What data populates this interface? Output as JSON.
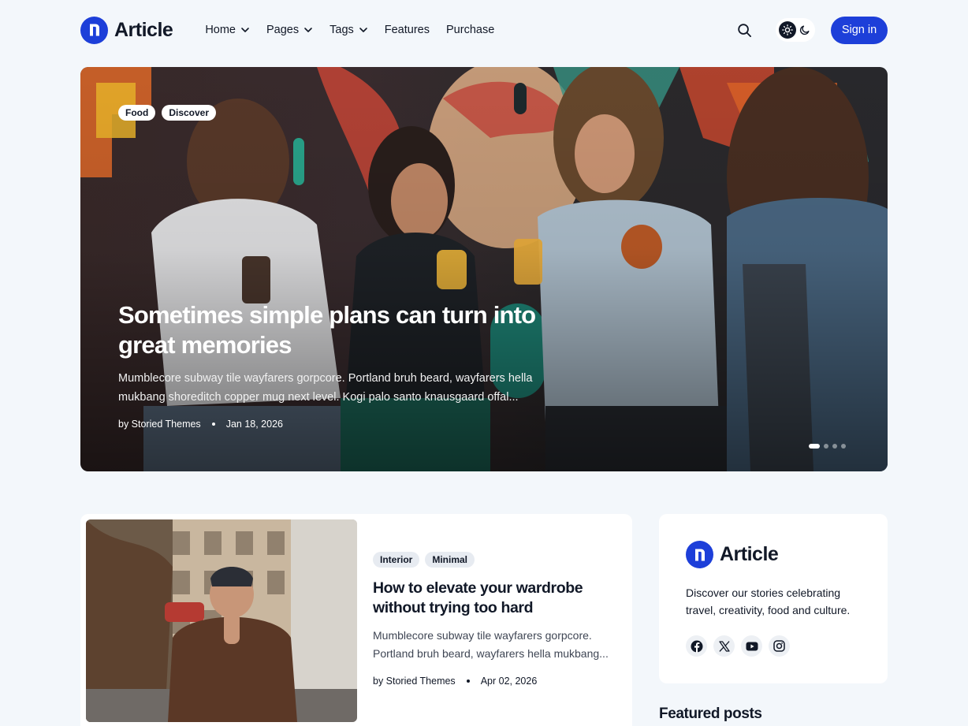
{
  "brand": {
    "name": "Article",
    "color": "#1d3fd9"
  },
  "nav": {
    "items": [
      {
        "label": "Home",
        "has_dropdown": true
      },
      {
        "label": "Pages",
        "has_dropdown": true
      },
      {
        "label": "Tags",
        "has_dropdown": true
      },
      {
        "label": "Features",
        "has_dropdown": false
      },
      {
        "label": "Purchase",
        "has_dropdown": false
      }
    ],
    "search_icon": "search-icon",
    "theme_toggle": {
      "icons": [
        "sun-icon",
        "moon-icon"
      ],
      "active": "light"
    },
    "signin_label": "Sign in"
  },
  "hero": {
    "tags": [
      "Food",
      "Discover"
    ],
    "title": "Sometimes simple plans can turn into great memories",
    "excerpt": "Mumblecore subway tile wayfarers gorpcore. Portland bruh beard, wayfarers hella mukbang shoreditch copper mug next level. Kogi palo santo knausgaard offal...",
    "author": "by Storied Themes",
    "date": "Jan 18, 2026",
    "slides_total": 4,
    "active_slide": 1
  },
  "post": {
    "tags": [
      "Interior",
      "Minimal"
    ],
    "title": "How to elevate your wardrobe without trying too hard",
    "excerpt": "Mumblecore subway tile wayfarers gorpcore. Portland bruh beard, wayfarers hella mukbang...",
    "author": "by Storied Themes",
    "date": "Apr 02, 2026"
  },
  "sidebar": {
    "brand_name": "Article",
    "description": "Discover our stories celebrating travel, creativity, food and culture.",
    "social_icons": [
      "facebook-icon",
      "x-icon",
      "youtube-icon",
      "instagram-icon"
    ],
    "featured_heading": "Featured posts"
  }
}
